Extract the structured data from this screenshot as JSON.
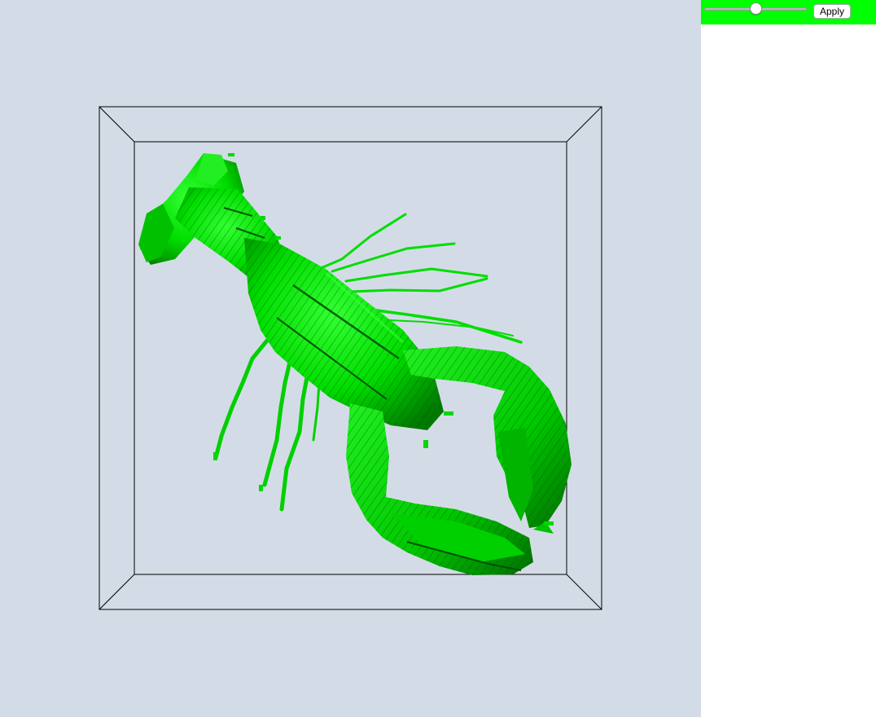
{
  "viewer": {
    "background_color": "#d3dce6",
    "isosurface_color": "#00ee00",
    "bounding_box_color": "#000000",
    "subject": "lobster-isosurface"
  },
  "controls": {
    "bar_color": "#00ff00",
    "iso_slider": {
      "value": 50,
      "min": 0,
      "max": 100
    },
    "apply_label": "Apply"
  }
}
